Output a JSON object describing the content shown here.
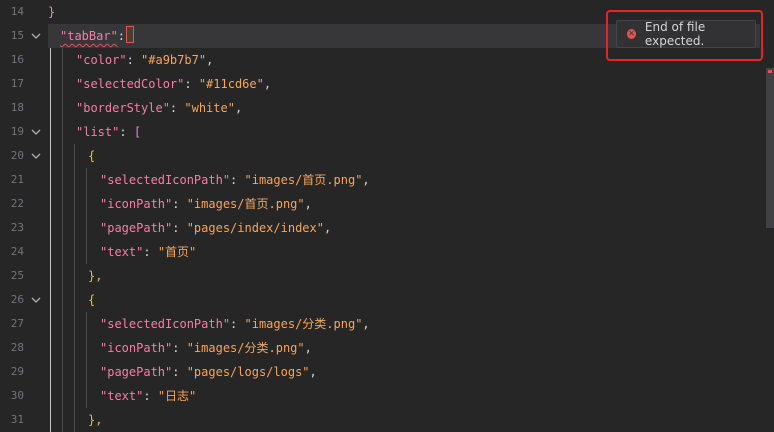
{
  "editor": {
    "line_numbers": [
      "14",
      "15",
      "16",
      "17",
      "18",
      "19",
      "20",
      "21",
      "22",
      "23",
      "24",
      "25",
      "26",
      "27",
      "28",
      "29",
      "30",
      "31"
    ],
    "lines": [
      {
        "brace": "}"
      },
      {
        "key": "\"tabBar\"",
        "colon": ":"
      },
      {
        "key": "\"color\"",
        "colon": ": ",
        "value": "\"#a9b7b7\"",
        "end": ","
      },
      {
        "key": "\"selectedColor\"",
        "colon": ": ",
        "value": "\"#11cd6e\"",
        "end": ","
      },
      {
        "key": "\"borderStyle\"",
        "colon": ": ",
        "value": "\"white\"",
        "end": ","
      },
      {
        "key": "\"list\"",
        "colon": ": ",
        "bracket": "["
      },
      {
        "brace": "{"
      },
      {
        "key": "\"selectedIconPath\"",
        "colon": ": ",
        "value": "\"images/首页.png\"",
        "end": ","
      },
      {
        "key": "\"iconPath\"",
        "colon": ": ",
        "value": "\"images/首页.png\"",
        "end": ","
      },
      {
        "key": "\"pagePath\"",
        "colon": ": ",
        "value": "\"pages/index/index\"",
        "end": ","
      },
      {
        "key": "\"text\"",
        "colon": ": ",
        "value": "\"首页\""
      },
      {
        "brace": "},"
      },
      {
        "brace": "{"
      },
      {
        "key": "\"selectedIconPath\"",
        "colon": ": ",
        "value": "\"images/分类.png\"",
        "end": ","
      },
      {
        "key": "\"iconPath\"",
        "colon": ": ",
        "value": "\"images/分类.png\"",
        "end": ","
      },
      {
        "key": "\"pagePath\"",
        "colon": ": ",
        "value": "\"pages/logs/logs\"",
        "end": ","
      },
      {
        "key": "\"text\"",
        "colon": ": ",
        "value": "\"日志\""
      },
      {
        "brace": "},"
      }
    ]
  },
  "diagnostic": {
    "message": "End of file expected.",
    "severity": "error"
  },
  "colors": {
    "key": "#f47fa6",
    "string": "#f8a45a",
    "error": "#e05656",
    "highlight_frame": "#ea2222"
  },
  "icons": {
    "fold": "chevron-down-icon",
    "error": "error-circle-icon"
  }
}
